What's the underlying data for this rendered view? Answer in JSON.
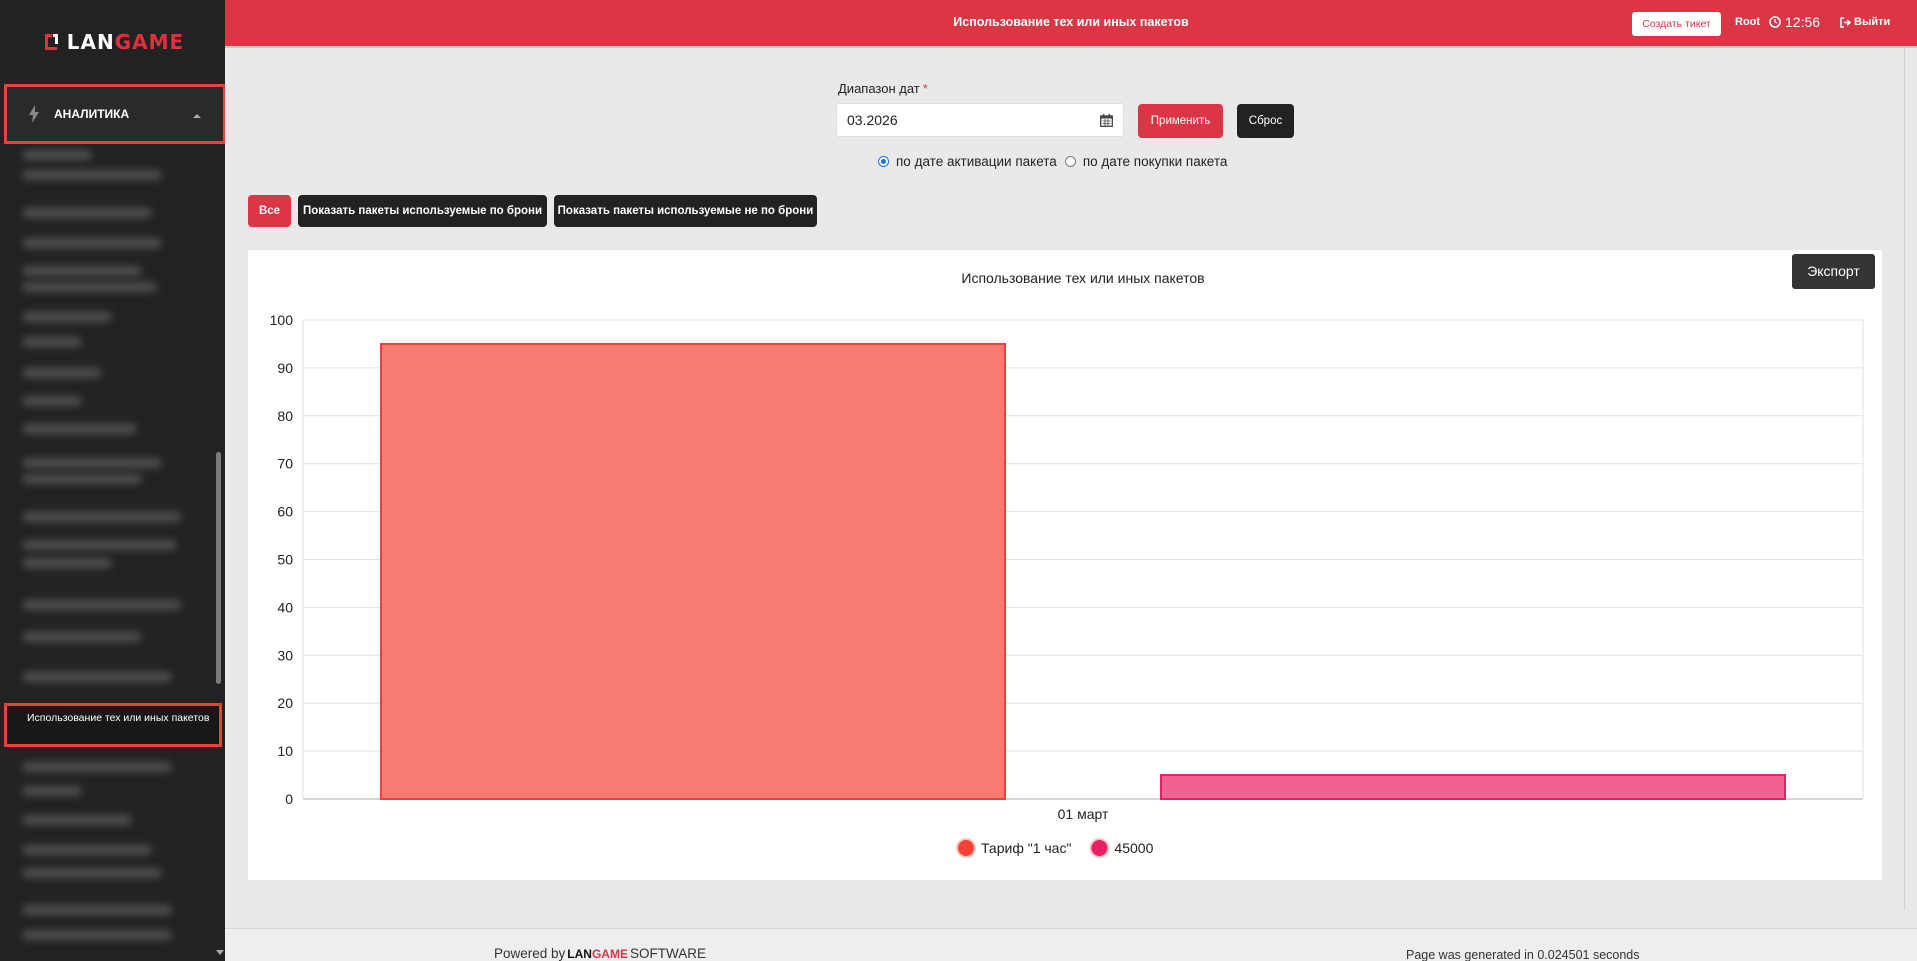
{
  "app": {
    "logo_left": "LAN",
    "logo_right": "GAME"
  },
  "sidebar": {
    "section_label": "АНАЛИТИКА",
    "active_item": "Использование тех или иных пакетов"
  },
  "topbar": {
    "title": "Использование тех или иных пакетов",
    "ticket_button": "Создать тикет",
    "user": "Root",
    "time": "12:56",
    "logout": "Выйти"
  },
  "filter": {
    "date_label": "Диапазон дат",
    "required_mark": "*",
    "date_value": "03.2026",
    "apply_button": "Применить",
    "reset_button": "Сброс",
    "radio_options": [
      {
        "label": "по дате активации пакета",
        "checked": true
      },
      {
        "label": "по дате покупки пакета",
        "checked": false
      }
    ],
    "buttons": {
      "all": "Все",
      "booked": "Показать пакеты используемые по брони",
      "not_booked": "Показать пакеты используемые не по брони"
    }
  },
  "panel": {
    "export_button": "Экспорт"
  },
  "chart_data": {
    "type": "bar",
    "title": "Использование тех или иных пакетов",
    "categories": [
      "01 март"
    ],
    "series": [
      {
        "name": "Тариф \"1 час\"",
        "values": [
          95
        ],
        "color": "#f77b72",
        "border": "#e8423a",
        "legend_color": "#f44336"
      },
      {
        "name": "45000",
        "values": [
          5
        ],
        "color": "#f06292",
        "border": "#e91e63",
        "legend_color": "#e91e63"
      }
    ],
    "ylim": [
      0,
      100
    ],
    "yticks": [
      0,
      10,
      20,
      30,
      40,
      50,
      60,
      70,
      80,
      90,
      100
    ],
    "grid": true,
    "legend_position": "bottom"
  },
  "footer": {
    "powered_by": "Powered by",
    "brand_left": "LAN",
    "brand_right": "GAME",
    "software": "SOFTWARE",
    "generated": "Page was generated in 0.024501 seconds"
  }
}
